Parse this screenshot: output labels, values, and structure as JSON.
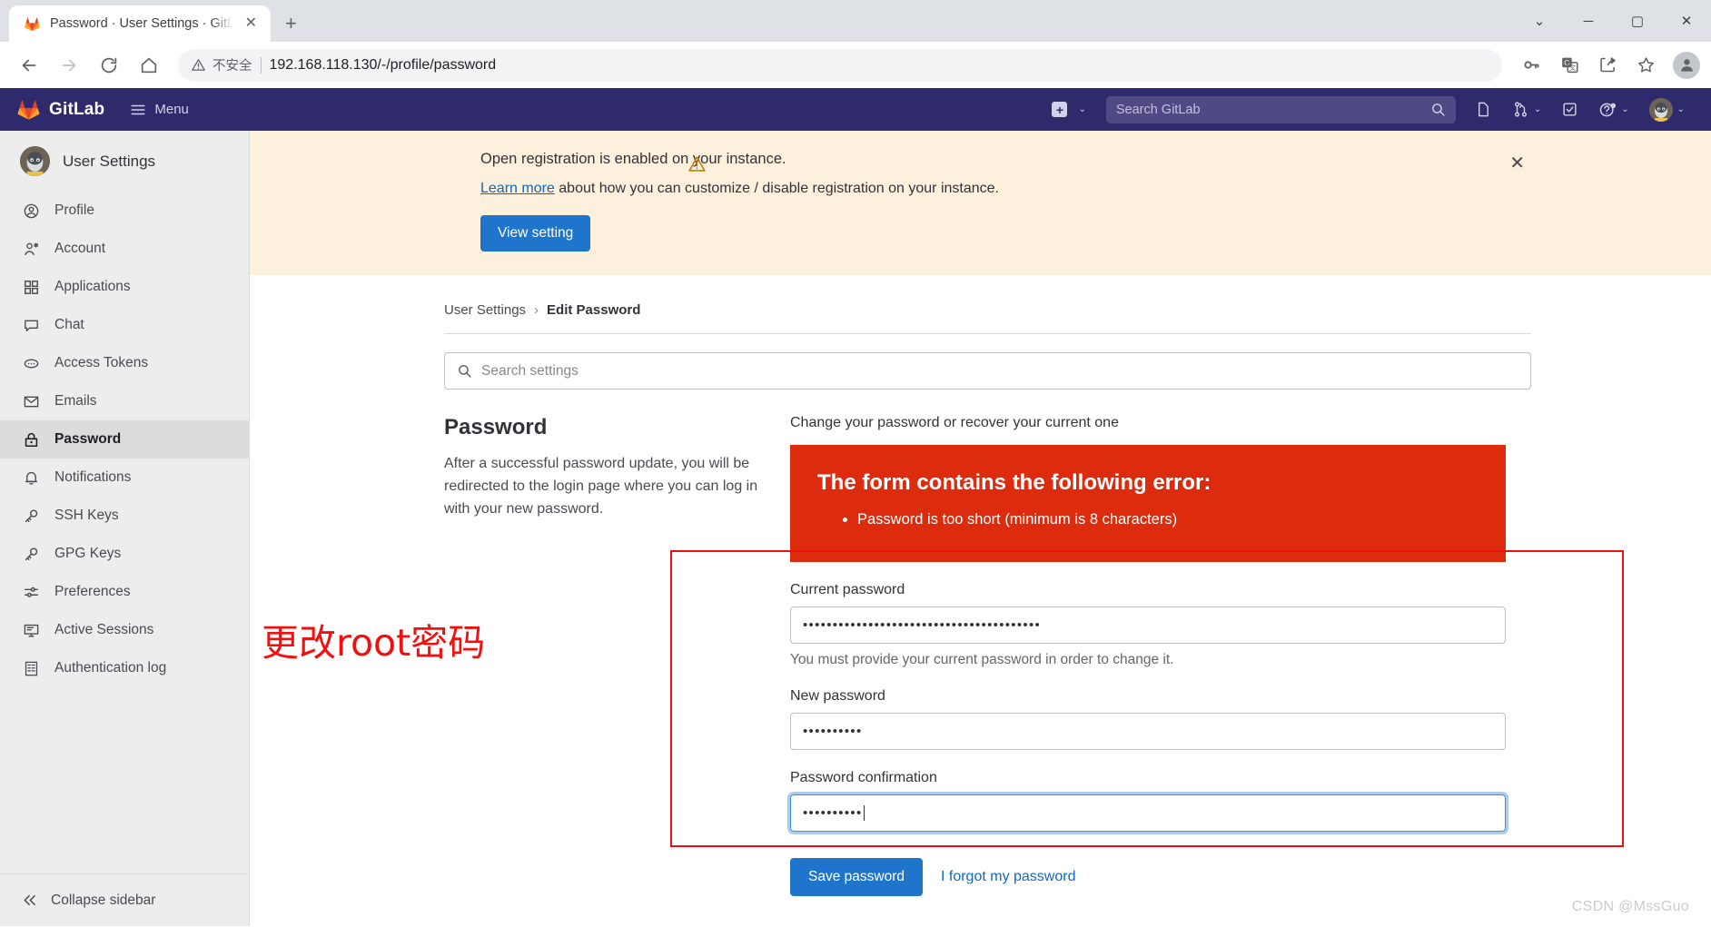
{
  "browser": {
    "tab": {
      "title": "Password · User Settings · GitL",
      "favicon": "gitlab-favicon",
      "close": "✕"
    },
    "newtab_label": "+",
    "window_controls": {
      "chevron": "⌄",
      "minimize": "─",
      "maximize": "▢",
      "close": "✕"
    },
    "nav": {
      "back": "←",
      "forward": "→",
      "reload": "⟳",
      "home": "⌂"
    },
    "omnibox": {
      "security_label": "不安全",
      "url": "192.168.118.130/-/profile/password"
    },
    "toolbar_icons": [
      "key-icon",
      "translate-icon",
      "share-icon",
      "bookmark-star-icon",
      "profile-avatar-icon"
    ]
  },
  "gitlab_nav": {
    "brand": "GitLab",
    "menu_label": "Menu",
    "create_label": "+",
    "search_placeholder": "Search GitLab",
    "icons": [
      "issues-icon",
      "merge-requests-icon",
      "todos-icon",
      "help-icon",
      "user-avatar"
    ]
  },
  "sidebar": {
    "title": "User Settings",
    "items": [
      {
        "label": "Profile",
        "icon": "profile-icon",
        "active": false
      },
      {
        "label": "Account",
        "icon": "account-icon",
        "active": false
      },
      {
        "label": "Applications",
        "icon": "applications-icon",
        "active": false
      },
      {
        "label": "Chat",
        "icon": "chat-icon",
        "active": false
      },
      {
        "label": "Access Tokens",
        "icon": "access-tokens-icon",
        "active": false
      },
      {
        "label": "Emails",
        "icon": "emails-icon",
        "active": false
      },
      {
        "label": "Password",
        "icon": "password-lock-icon",
        "active": true
      },
      {
        "label": "Notifications",
        "icon": "notifications-bell-icon",
        "active": false
      },
      {
        "label": "SSH Keys",
        "icon": "ssh-key-icon",
        "active": false
      },
      {
        "label": "GPG Keys",
        "icon": "gpg-key-icon",
        "active": false
      },
      {
        "label": "Preferences",
        "icon": "preferences-icon",
        "active": false
      },
      {
        "label": "Active Sessions",
        "icon": "active-sessions-icon",
        "active": false
      },
      {
        "label": "Authentication log",
        "icon": "authentication-log-icon",
        "active": false
      }
    ],
    "collapse_label": "Collapse sidebar"
  },
  "alert": {
    "icon": "warning-triangle-icon",
    "title": "Open registration is enabled on your instance.",
    "link_text": "Learn more",
    "desc_rest": " about how you can customize / disable registration on your instance.",
    "button_label": "View setting",
    "close": "✕"
  },
  "breadcrumb": {
    "root": "User Settings",
    "separator": "›",
    "current": "Edit Password"
  },
  "search_settings": {
    "placeholder": "Search settings",
    "icon": "search-icon"
  },
  "password_section": {
    "heading": "Password",
    "description": "After a successful password update, you will be redirected to the login page where you can log in with your new password.",
    "legend": "Change your password or recover your current one"
  },
  "error_box": {
    "title": "The form contains the following error:",
    "items": [
      "Password is too short (minimum is 8 characters)"
    ],
    "color": "#dd2b0e"
  },
  "form": {
    "current_password": {
      "label": "Current password",
      "value": "••••••••••••••••••••••••••••••••••••••••",
      "help": "You must provide your current password in order to change it."
    },
    "new_password": {
      "label": "New password",
      "value": "••••••••••"
    },
    "password_confirmation": {
      "label": "Password confirmation",
      "value": "••••••••••",
      "focused": true
    },
    "save_label": "Save password",
    "forgot_label": "I forgot my password"
  },
  "annotations": {
    "note_cn": "更改root密码",
    "note_color": "#f11010",
    "watermark": "CSDN @MssGuo"
  },
  "colors": {
    "gitlab_nav": "#2f2a6b",
    "primary_button": "#1f75cb",
    "alert_bg": "#fdf1dd",
    "error_bg": "#dd2b0e",
    "link": "#1068bf"
  }
}
